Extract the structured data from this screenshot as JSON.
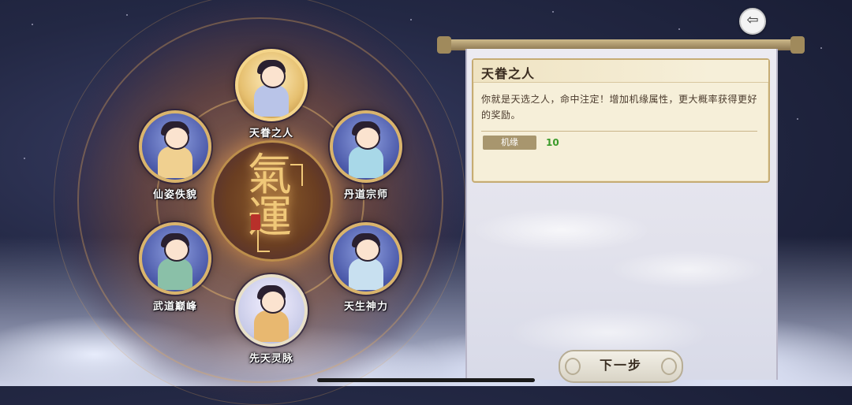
{
  "nav": {
    "back_icon": "⇦"
  },
  "center": {
    "glyph": "氣運",
    "seal_text": ""
  },
  "talents": [
    {
      "id": "top",
      "label": "天眷之人",
      "style": "gold",
      "body_color": "#b9c4e8"
    },
    {
      "id": "upper-left",
      "label": "仙姿佚貌",
      "style": "blue",
      "body_color": "#f0d090"
    },
    {
      "id": "upper-right",
      "label": "丹道宗师",
      "style": "blue",
      "body_color": "#a8d8e8"
    },
    {
      "id": "lower-left",
      "label": "武道巅峰",
      "style": "blue",
      "body_color": "#8ac0a8"
    },
    {
      "id": "lower-right",
      "label": "天生神力",
      "style": "blue",
      "body_color": "#c8e0f0"
    },
    {
      "id": "bottom",
      "label": "先天灵脉",
      "style": "white",
      "body_color": "#e8b870"
    }
  ],
  "detail": {
    "title": "天眷之人",
    "description": "你就是天选之人，命中注定！增加机缘属性，更大概率获得更好的奖励。",
    "attribute": {
      "name": "机缘",
      "value": "10"
    }
  },
  "footer": {
    "next_label": "下一步"
  },
  "colors": {
    "accent_gold": "#d9b46c",
    "attr_green": "#3a9a2a"
  }
}
